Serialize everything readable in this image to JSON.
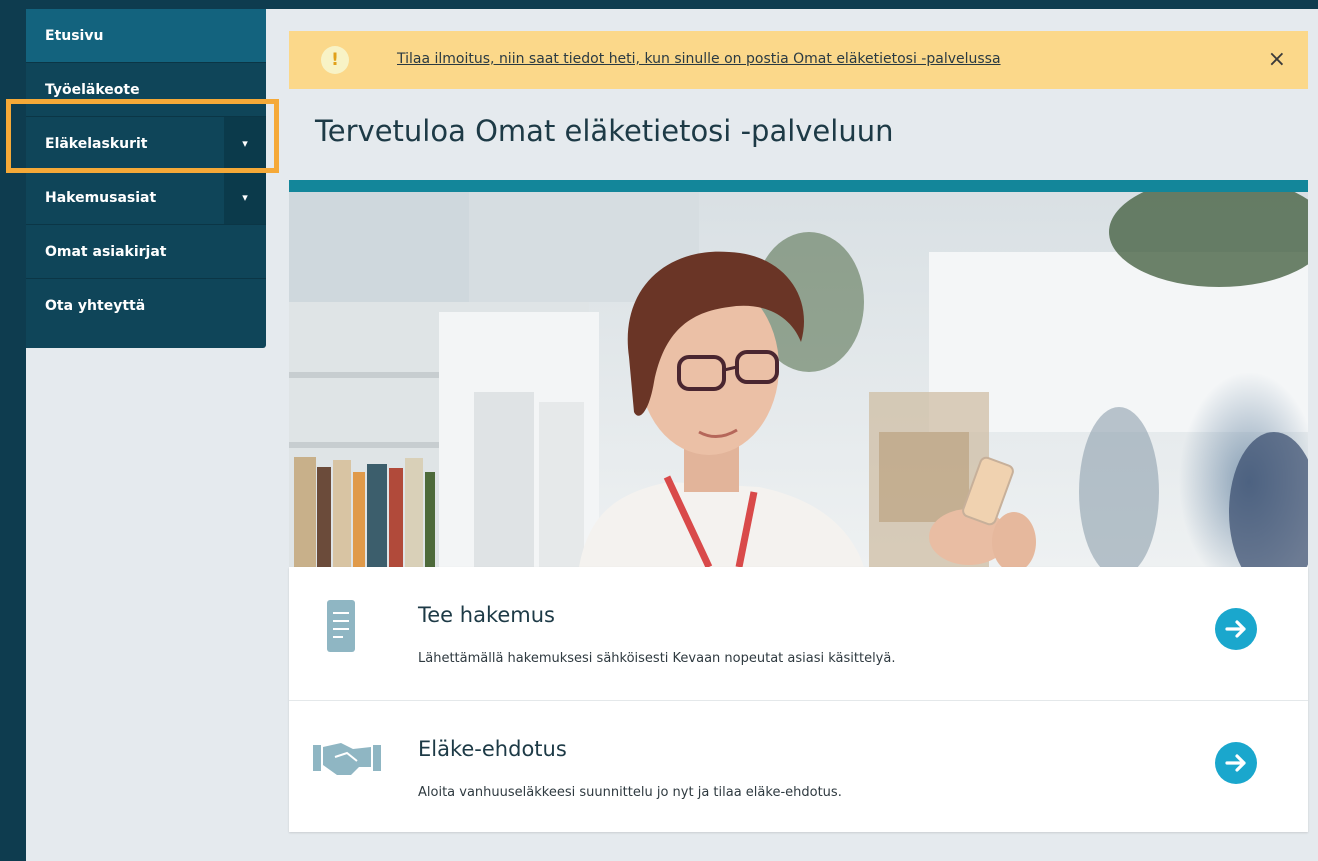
{
  "sidebar": {
    "items": [
      {
        "label": "Etusivu"
      },
      {
        "label": "Työeläkeote"
      },
      {
        "label": "Eläkelaskurit",
        "caret": "▾"
      },
      {
        "label": "Hakemusasiat",
        "caret": "▾"
      },
      {
        "label": "Omat asiakirjat"
      },
      {
        "label": "Ota yhteyttä"
      }
    ]
  },
  "notice": {
    "icon": "!",
    "text": "Tilaa ilmoitus, niin saat tiedot heti, kun sinulle on postia Omat eläketietosi -palvelussa",
    "close": "×"
  },
  "page": {
    "title": "Tervetuloa Omat eläketietosi -palveluun"
  },
  "cards": [
    {
      "title": "Tee hakemus",
      "description": "Lähettämällä hakemuksesi sähköisesti Kevaan nopeutat asiasi käsittelyä.",
      "icon": "document-icon"
    },
    {
      "title": "Eläke-ehdotus",
      "description": "Aloita vanhuuseläkkeesi suunnittelu jo nyt ja tilaa eläke-ehdotus.",
      "icon": "handshake-icon"
    }
  ],
  "colors": {
    "sidebar": "#0f4559",
    "sidebar_active": "#13637e",
    "highlight": "#f5a938",
    "notice": "#fbd88a",
    "accent_bar": "#13869a",
    "arrow_button": "#1aa7cd"
  }
}
